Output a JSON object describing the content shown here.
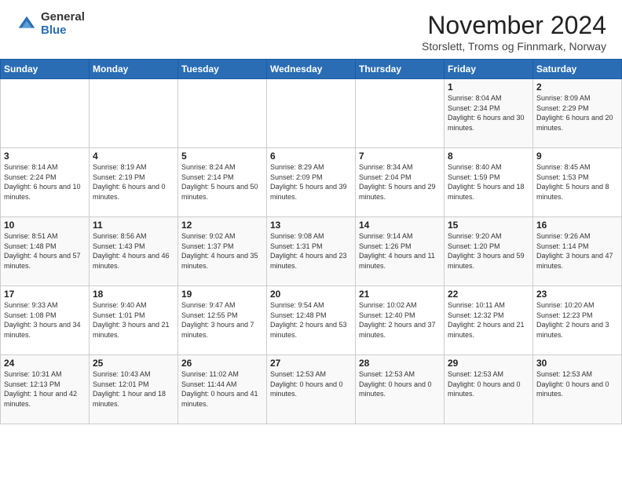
{
  "logo": {
    "general": "General",
    "blue": "Blue"
  },
  "title": "November 2024",
  "subtitle": "Storslett, Troms og Finnmark, Norway",
  "days_of_week": [
    "Sunday",
    "Monday",
    "Tuesday",
    "Wednesday",
    "Thursday",
    "Friday",
    "Saturday"
  ],
  "weeks": [
    [
      {
        "day": "",
        "info": ""
      },
      {
        "day": "",
        "info": ""
      },
      {
        "day": "",
        "info": ""
      },
      {
        "day": "",
        "info": ""
      },
      {
        "day": "",
        "info": ""
      },
      {
        "day": "1",
        "info": "Sunrise: 8:04 AM\nSunset: 2:34 PM\nDaylight: 6 hours and 30 minutes."
      },
      {
        "day": "2",
        "info": "Sunrise: 8:09 AM\nSunset: 2:29 PM\nDaylight: 6 hours and 20 minutes."
      }
    ],
    [
      {
        "day": "3",
        "info": "Sunrise: 8:14 AM\nSunset: 2:24 PM\nDaylight: 6 hours and 10 minutes."
      },
      {
        "day": "4",
        "info": "Sunrise: 8:19 AM\nSunset: 2:19 PM\nDaylight: 6 hours and 0 minutes."
      },
      {
        "day": "5",
        "info": "Sunrise: 8:24 AM\nSunset: 2:14 PM\nDaylight: 5 hours and 50 minutes."
      },
      {
        "day": "6",
        "info": "Sunrise: 8:29 AM\nSunset: 2:09 PM\nDaylight: 5 hours and 39 minutes."
      },
      {
        "day": "7",
        "info": "Sunrise: 8:34 AM\nSunset: 2:04 PM\nDaylight: 5 hours and 29 minutes."
      },
      {
        "day": "8",
        "info": "Sunrise: 8:40 AM\nSunset: 1:59 PM\nDaylight: 5 hours and 18 minutes."
      },
      {
        "day": "9",
        "info": "Sunrise: 8:45 AM\nSunset: 1:53 PM\nDaylight: 5 hours and 8 minutes."
      }
    ],
    [
      {
        "day": "10",
        "info": "Sunrise: 8:51 AM\nSunset: 1:48 PM\nDaylight: 4 hours and 57 minutes."
      },
      {
        "day": "11",
        "info": "Sunrise: 8:56 AM\nSunset: 1:43 PM\nDaylight: 4 hours and 46 minutes."
      },
      {
        "day": "12",
        "info": "Sunrise: 9:02 AM\nSunset: 1:37 PM\nDaylight: 4 hours and 35 minutes."
      },
      {
        "day": "13",
        "info": "Sunrise: 9:08 AM\nSunset: 1:31 PM\nDaylight: 4 hours and 23 minutes."
      },
      {
        "day": "14",
        "info": "Sunrise: 9:14 AM\nSunset: 1:26 PM\nDaylight: 4 hours and 11 minutes."
      },
      {
        "day": "15",
        "info": "Sunrise: 9:20 AM\nSunset: 1:20 PM\nDaylight: 3 hours and 59 minutes."
      },
      {
        "day": "16",
        "info": "Sunrise: 9:26 AM\nSunset: 1:14 PM\nDaylight: 3 hours and 47 minutes."
      }
    ],
    [
      {
        "day": "17",
        "info": "Sunrise: 9:33 AM\nSunset: 1:08 PM\nDaylight: 3 hours and 34 minutes."
      },
      {
        "day": "18",
        "info": "Sunrise: 9:40 AM\nSunset: 1:01 PM\nDaylight: 3 hours and 21 minutes."
      },
      {
        "day": "19",
        "info": "Sunrise: 9:47 AM\nSunset: 12:55 PM\nDaylight: 3 hours and 7 minutes."
      },
      {
        "day": "20",
        "info": "Sunrise: 9:54 AM\nSunset: 12:48 PM\nDaylight: 2 hours and 53 minutes."
      },
      {
        "day": "21",
        "info": "Sunrise: 10:02 AM\nSunset: 12:40 PM\nDaylight: 2 hours and 37 minutes."
      },
      {
        "day": "22",
        "info": "Sunrise: 10:11 AM\nSunset: 12:32 PM\nDaylight: 2 hours and 21 minutes."
      },
      {
        "day": "23",
        "info": "Sunrise: 10:20 AM\nSunset: 12:23 PM\nDaylight: 2 hours and 3 minutes."
      }
    ],
    [
      {
        "day": "24",
        "info": "Sunrise: 10:31 AM\nSunset: 12:13 PM\nDaylight: 1 hour and 42 minutes."
      },
      {
        "day": "25",
        "info": "Sunrise: 10:43 AM\nSunset: 12:01 PM\nDaylight: 1 hour and 18 minutes."
      },
      {
        "day": "26",
        "info": "Sunrise: 11:02 AM\nSunset: 11:44 AM\nDaylight: 0 hours and 41 minutes."
      },
      {
        "day": "27",
        "info": "Sunset: 12:53 AM\nDaylight: 0 hours and 0 minutes."
      },
      {
        "day": "28",
        "info": "Sunset: 12:53 AM\nDaylight: 0 hours and 0 minutes."
      },
      {
        "day": "29",
        "info": "Sunset: 12:53 AM\nDaylight: 0 hours and 0 minutes."
      },
      {
        "day": "30",
        "info": "Sunset: 12:53 AM\nDaylight: 0 hours and 0 minutes."
      }
    ]
  ]
}
